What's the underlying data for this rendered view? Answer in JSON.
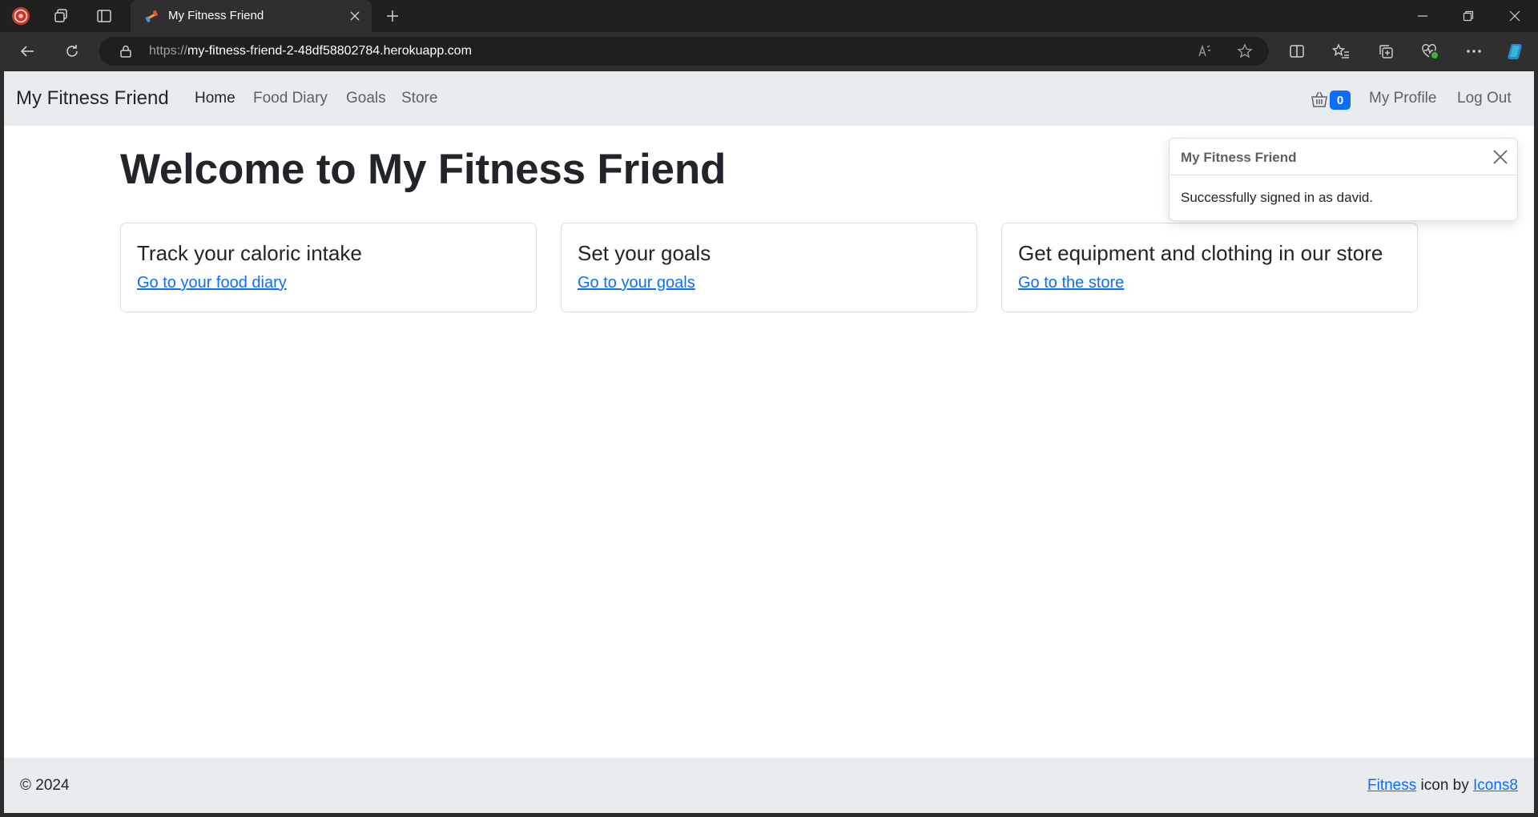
{
  "browser": {
    "tab_title": "My Fitness Friend",
    "url_scheme": "https://",
    "url_host": "my-fitness-friend-2-48df58802784.herokuapp.com",
    "icons": {
      "profile": "browser-profile-icon",
      "workspaces": "workspaces-icon",
      "tab_actions": "tab-actions-icon",
      "favicon": "dumbbell-favicon-icon",
      "close_tab": "close-icon",
      "new_tab": "plus-icon",
      "minimize": "minimize-icon",
      "restore": "restore-icon",
      "close_window": "close-icon",
      "back": "back-arrow-icon",
      "refresh": "refresh-icon",
      "lock": "lock-icon",
      "read_aloud": "read-aloud-icon",
      "favorite": "star-icon",
      "split_screen": "split-screen-icon",
      "favorites": "favorites-icon",
      "collections": "collections-icon",
      "performance": "heart-pulse-icon",
      "more": "more-icon",
      "copilot": "copilot-icon"
    }
  },
  "navbar": {
    "brand": "My Fitness Friend",
    "links": [
      {
        "label": "Home",
        "active": true
      },
      {
        "label": "Food Diary",
        "active": false
      },
      {
        "label": "Goals",
        "active": false
      },
      {
        "label": "Store",
        "active": false
      }
    ],
    "cart_count": "0",
    "profile_label": "My Profile",
    "logout_label": "Log Out"
  },
  "main": {
    "title": "Welcome to My Fitness Friend",
    "cards": [
      {
        "title": "Track your caloric intake",
        "link": "Go to your food diary"
      },
      {
        "title": "Set your goals",
        "link": "Go to your goals"
      },
      {
        "title": "Get equipment and clothing in our store",
        "link": "Go to the store"
      }
    ]
  },
  "toast": {
    "title": "My Fitness Friend",
    "message": "Successfully signed in as david."
  },
  "footer": {
    "copyright": "© 2024",
    "credit_link1": "Fitness",
    "credit_middle": " icon by ",
    "credit_link2": "Icons8"
  },
  "colors": {
    "accent": "#0d6efd",
    "navbar_bg": "#e9ecef",
    "chrome_bg": "#202020"
  }
}
